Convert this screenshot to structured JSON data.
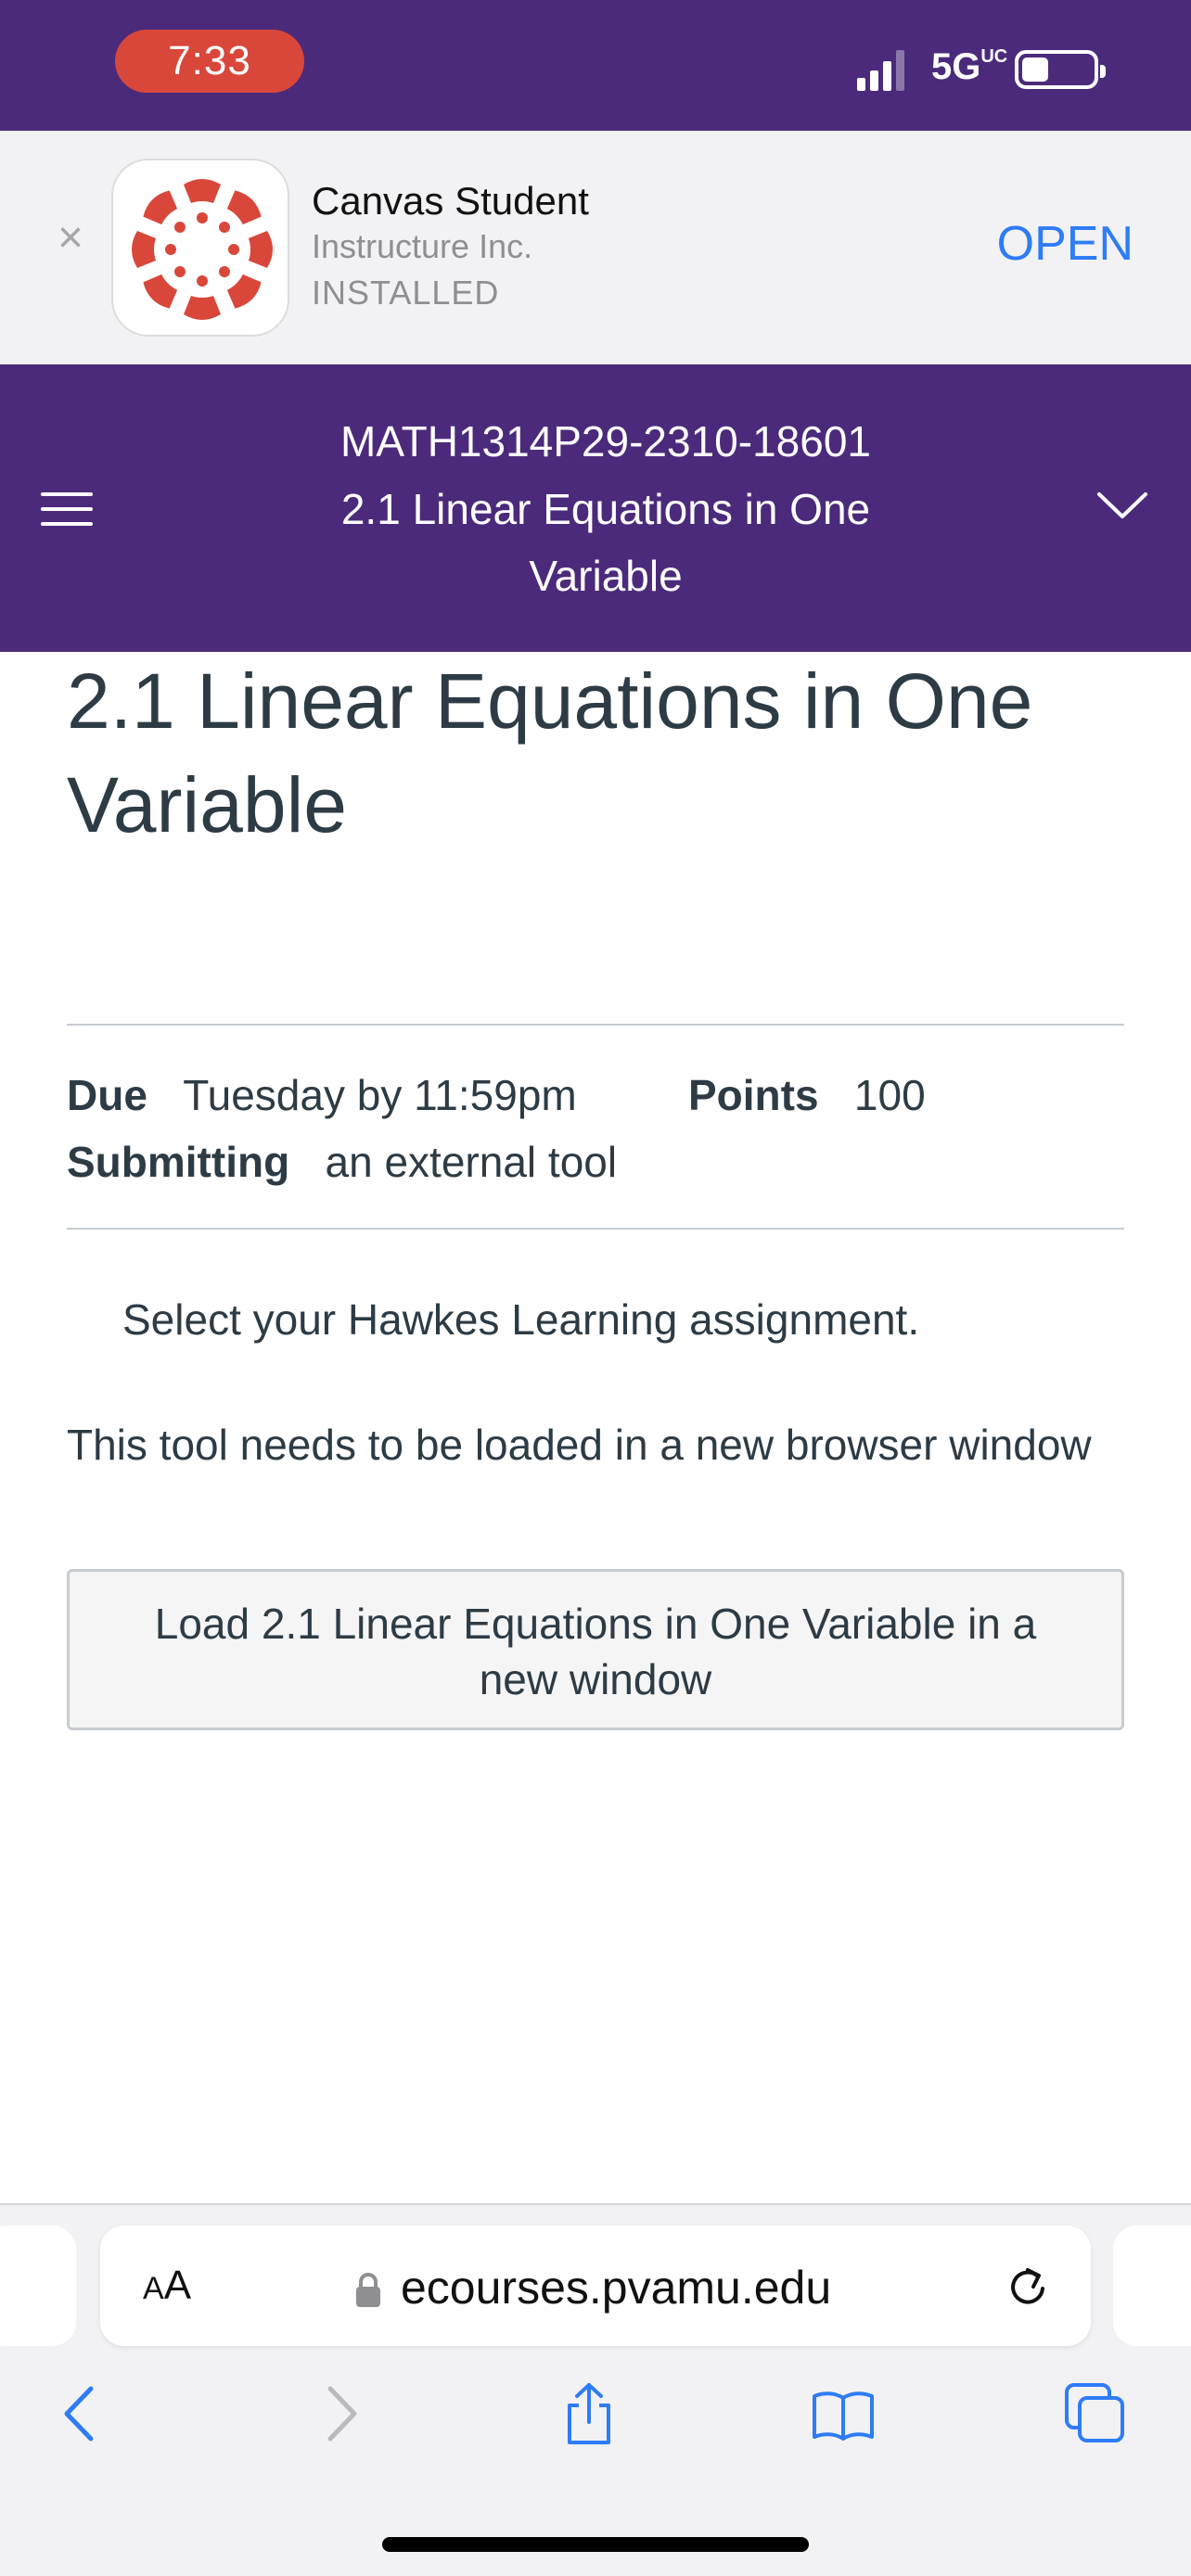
{
  "status_bar": {
    "time": "7:33",
    "network": "5G",
    "network_suffix": "UC"
  },
  "app_banner": {
    "name": "Canvas Student",
    "vendor": "Instructure Inc.",
    "status": "INSTALLED",
    "open_label": "OPEN",
    "icon_color": "#d9473a"
  },
  "course_header": {
    "course_code": "MATH1314P29-2310-18601",
    "page_title": "2.1 Linear Equations in One Variable",
    "background": "#4b2a7b"
  },
  "assignment": {
    "title": "2.1 Linear Equations in One Variable",
    "due_label": "Due",
    "due_value": "Tuesday by 11:59pm",
    "points_label": "Points",
    "points_value": "100",
    "submitting_label": "Submitting",
    "submitting_value": "an external tool",
    "instruction": "Select your Hawkes Learning assignment.",
    "tool_note": "This tool needs to be loaded in a new browser window",
    "load_button_line1": "Load 2.1 Linear Equations in One Variable in a",
    "load_button_line2": "new window"
  },
  "browser": {
    "text_size_label_a": "A",
    "text_size_label_b": "A",
    "url": "ecourses.pvamu.edu",
    "accent": "#2e7cf6"
  }
}
